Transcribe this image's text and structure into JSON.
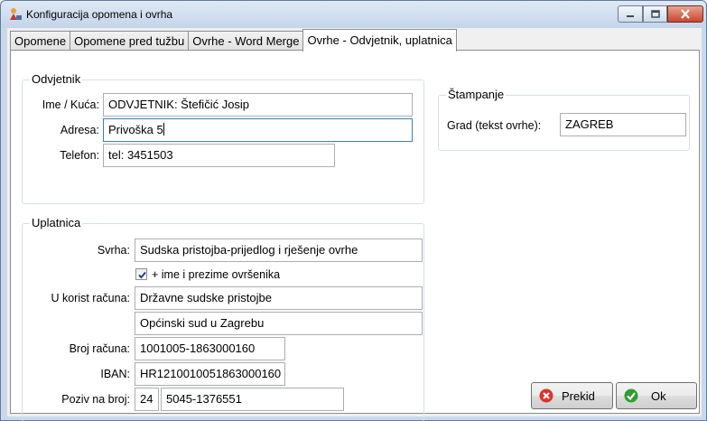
{
  "window": {
    "title": "Konfiguracija opomena i ovrha"
  },
  "tabs": [
    {
      "label": "Opomene"
    },
    {
      "label": "Opomene pred tužbu"
    },
    {
      "label": "Ovrhe - Word Merge"
    },
    {
      "label": "Ovrhe - Odvjetnik, uplatnica"
    }
  ],
  "odvjetnik": {
    "legend": "Odvjetnik",
    "ime_label": "Ime / Kuća:",
    "ime_value": "ODVJETNIK: Štefičić Josip",
    "adresa_label": "Adresa:",
    "adresa_value": "Privoška 5",
    "telefon_label": "Telefon:",
    "telefon_value": "tel: 3451503"
  },
  "stampanje": {
    "legend": "Štampanje",
    "grad_label": "Grad (tekst ovrhe):",
    "grad_value": "ZAGREB"
  },
  "uplatnica": {
    "legend": "Uplatnica",
    "svrha_label": "Svrha:",
    "svrha_value": "Sudska pristojba-prijedlog i rješenje ovrhe",
    "checkbox_label": "+ ime i prezime ovršenika",
    "checkbox_checked": true,
    "korist_label": "U korist računa:",
    "korist_value1": "Državne sudske pristojbe",
    "korist_value2": "Općinski sud u Zagrebu",
    "broj_label": "Broj računa:",
    "broj_value": "1001005-1863000160",
    "iban_label": "IBAN:",
    "iban_value": "HR1210010051863000160",
    "poziv_label": "Poziv na broj:",
    "poziv_model": "24",
    "poziv_value": "5045-1376551"
  },
  "buttons": {
    "prekid": "Prekid",
    "ok": "Ok"
  },
  "colors": {
    "cancel_icon": "#d9342b",
    "ok_icon": "#2f9e2f"
  }
}
